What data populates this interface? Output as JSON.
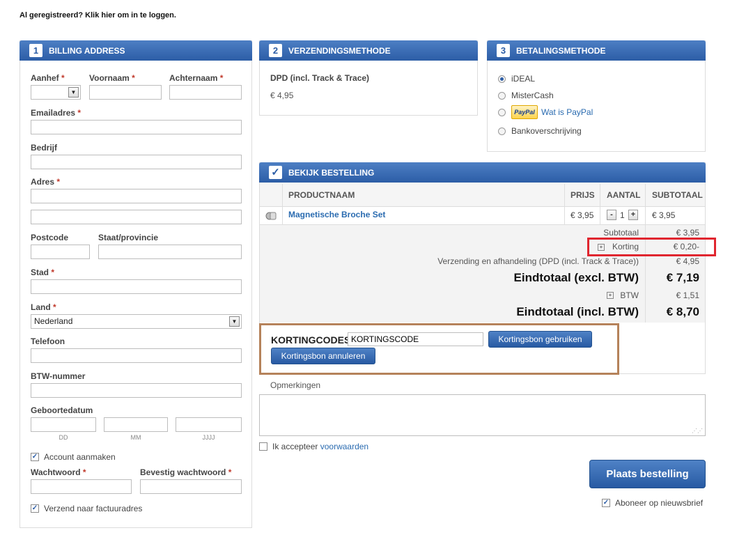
{
  "login_link": "Al geregistreerd? Klik hier om in te loggen.",
  "billing": {
    "step": "1",
    "title": "BILLING ADDRESS",
    "aanhef_label": "Aanhef",
    "voornaam_label": "Voornaam",
    "achternaam_label": "Achternaam",
    "email_label": "Emailadres",
    "bedrijf_label": "Bedrijf",
    "adres_label": "Adres",
    "postcode_label": "Postcode",
    "provincie_label": "Staat/provincie",
    "stad_label": "Stad",
    "land_label": "Land",
    "land_value": "Nederland",
    "telefoon_label": "Telefoon",
    "btw_label": "BTW-nummer",
    "geboortedatum_label": "Geboortedatum",
    "dd": "DD",
    "mm": "MM",
    "jjjj": "JJJJ",
    "account_label": "Account aanmaken",
    "wachtwoord_label": "Wachtwoord",
    "bevestig_label": "Bevestig wachtwoord",
    "verzend_label": "Verzend naar factuuradres",
    "required_mark": "*"
  },
  "shipping": {
    "step": "2",
    "title": "VERZENDINGSMETHODE",
    "method": "DPD (incl. Track & Trace)",
    "price": "€ 4,95"
  },
  "payment": {
    "step": "3",
    "title": "BETALINGSMETHODE",
    "options": [
      "iDEAL",
      "MisterCash",
      "Wat is PayPal",
      "Bankoverschrijving"
    ],
    "paypal_logo": "PayPal"
  },
  "order": {
    "title": "BEKIJK BESTELLING",
    "check": "✓",
    "headers": {
      "product": "PRODUCTNAAM",
      "price": "PRIJS",
      "qty": "AANTAL",
      "subtotal": "SUBTOTAAL"
    },
    "item": {
      "name": "Magnetische Broche Set",
      "price": "€ 3,95",
      "qty": "1",
      "subtotal": "€ 3,95"
    },
    "summary": {
      "subtotaal_label": "Subtotaal",
      "subtotaal_value": "€ 3,95",
      "korting_label": "Korting",
      "korting_value": "€ 0,20-",
      "verzending_label": "Verzending en afhandeling (DPD (incl. Track & Trace))",
      "verzending_value": "€ 4,95",
      "excl_label": "Eindtotaal (excl. BTW)",
      "excl_value": "€ 7,19",
      "btw_label": "BTW",
      "btw_value": "€ 1,51",
      "incl_label": "Eindtotaal (incl. BTW)",
      "incl_value": "€ 8,70"
    },
    "qty_minus": "-",
    "qty_plus": "+",
    "expand": "+"
  },
  "coupon": {
    "label": "KORTINGCODES",
    "input_value": "KORTINGSCODE",
    "apply_button": "Kortingsbon gebruiken",
    "cancel_button": "Kortingsbon annuleren"
  },
  "remarks_label": "Opmerkingen",
  "terms": {
    "prefix": "Ik accepteer",
    "link": "voorwaarden"
  },
  "place_order": "Plaats bestelling",
  "newsletter": "Aboneer op nieuwsbrief",
  "checkmark": "✓",
  "colors": {
    "header_blue": "#2c5da6",
    "link_blue": "#2a6bb0",
    "highlight_red": "#e0262f",
    "coupon_border": "#b5825a",
    "required_red": "#c0392b"
  }
}
